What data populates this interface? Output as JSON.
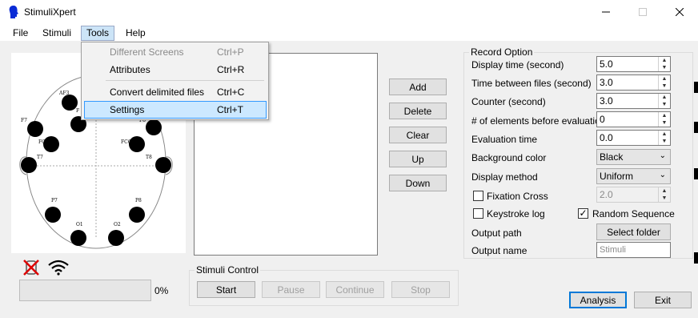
{
  "window": {
    "title": "StimuliXpert"
  },
  "menu": {
    "file": "File",
    "stimuli": "Stimuli",
    "tools": "Tools",
    "help": "Help"
  },
  "tools_menu": {
    "items": [
      {
        "label": "Different Screens",
        "shortcut": "Ctrl+P",
        "enabled": false
      },
      {
        "label": "Attributes",
        "shortcut": "Ctrl+R",
        "enabled": true
      },
      {
        "label": "Convert delimited files",
        "shortcut": "Ctrl+C",
        "enabled": true
      },
      {
        "label": "Settings",
        "shortcut": "Ctrl+T",
        "enabled": true,
        "highlighted": true
      }
    ]
  },
  "electrodes": [
    "AF3",
    "F",
    "F7",
    "F8",
    "FC5",
    "FC6",
    "T7",
    "T8",
    "P7",
    "P8",
    "O1",
    "O2"
  ],
  "status": {
    "progress_percent": 0,
    "progress_label": "0%"
  },
  "list_buttons": {
    "add": "Add",
    "delete": "Delete",
    "clear": "Clear",
    "up": "Up",
    "down": "Down"
  },
  "stimuli_control": {
    "title": "Stimuli Control",
    "start": "Start",
    "pause": "Pause",
    "continue": "Continue",
    "stop": "Stop"
  },
  "record_option": {
    "title": "Record Option",
    "display_time_label": "Display time (second)",
    "display_time": "5.0",
    "between_files_label": "Time between files (second)",
    "between_files": "3.0",
    "counter_label": "Counter (second)",
    "counter": "3.0",
    "elements_label": "# of elements before evaluation",
    "elements": "0",
    "evaluation_time_label": "Evaluation time",
    "evaluation_time": "0.0",
    "background_color_label": "Background color",
    "background_color": "Black",
    "display_method_label": "Display method",
    "display_method": "Uniform",
    "fixation_cross_label": "Fixation Cross",
    "fixation_cross_checked": false,
    "fixation_value": "2.0",
    "keystroke_log_label": "Keystroke log",
    "keystroke_log_checked": false,
    "random_sequence_label": "Random Sequence",
    "random_sequence_checked": true,
    "output_path_label": "Output path",
    "select_folder": "Select  folder",
    "output_name_label": "Output name",
    "output_name_placeholder": "Stimuli"
  },
  "footer": {
    "analysis": "Analysis",
    "exit": "Exit"
  },
  "colors": {
    "menu_highlight": "#cce8ff",
    "menu_highlight_border": "#3399ff",
    "accent": "#0078d7",
    "app_icon": "#0a2bd6"
  }
}
